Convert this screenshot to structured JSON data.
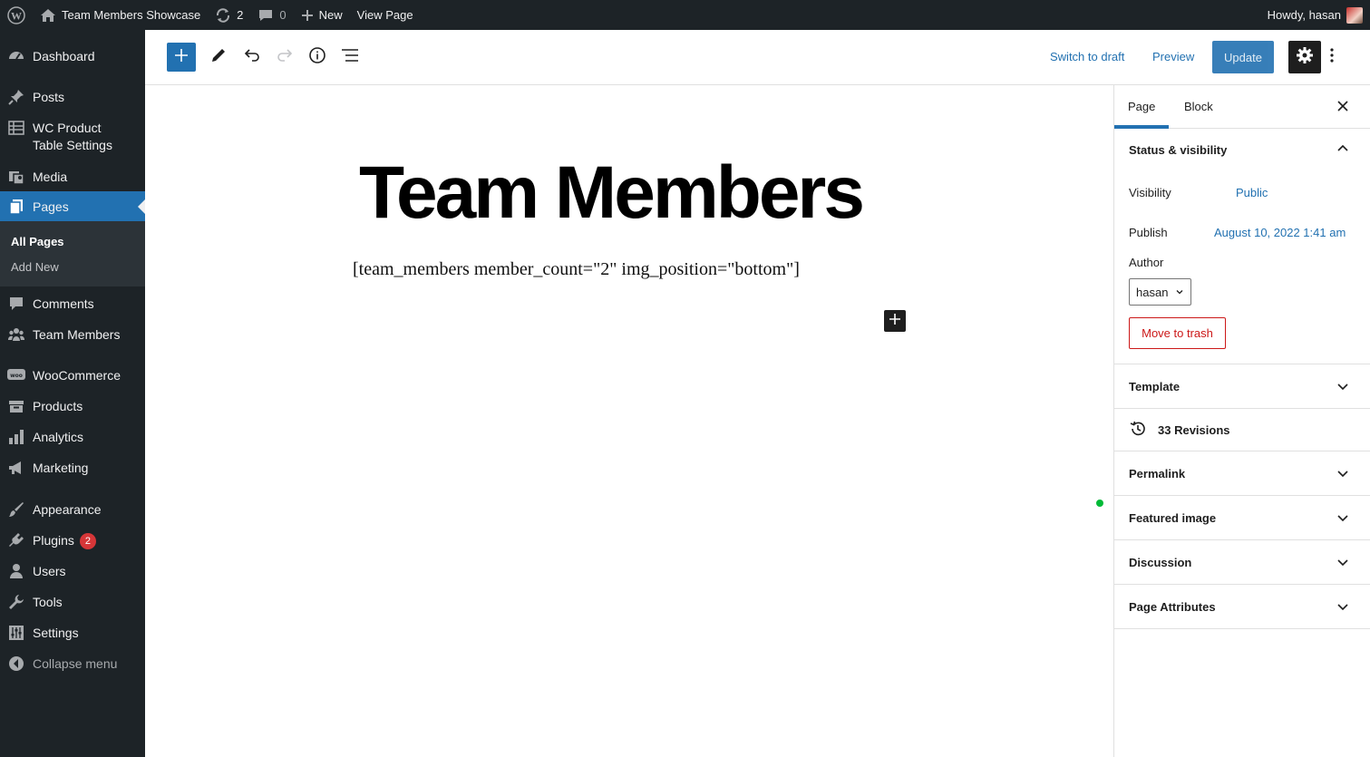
{
  "admin_bar": {
    "site_name": "Team Members Showcase",
    "updates_count": "2",
    "comments_count": "0",
    "new_label": "New",
    "view_page_label": "View Page",
    "howdy": "Howdy, hasan"
  },
  "sidebar": {
    "items": [
      {
        "label": "Dashboard",
        "icon": "dashboard-icon"
      },
      {
        "label": "Posts",
        "icon": "pin-icon"
      },
      {
        "label": "WC Product",
        "label2": "Table Settings",
        "icon": "table-icon"
      },
      {
        "label": "Media",
        "icon": "media-icon"
      },
      {
        "label": "Pages",
        "icon": "pages-icon"
      },
      {
        "label": "Comments",
        "icon": "comment-icon"
      },
      {
        "label": "Team Members",
        "icon": "groups-icon"
      },
      {
        "label": "WooCommerce",
        "icon": "woo-icon"
      },
      {
        "label": "Products",
        "icon": "archive-icon"
      },
      {
        "label": "Analytics",
        "icon": "bar-chart-icon"
      },
      {
        "label": "Marketing",
        "icon": "megaphone-icon"
      },
      {
        "label": "Appearance",
        "icon": "brush-icon"
      },
      {
        "label": "Plugins",
        "icon": "plugin-icon",
        "badge": "2"
      },
      {
        "label": "Users",
        "icon": "user-icon"
      },
      {
        "label": "Tools",
        "icon": "wrench-icon"
      },
      {
        "label": "Settings",
        "icon": "settings-icon"
      },
      {
        "label": "Collapse menu",
        "icon": "collapse-icon"
      }
    ],
    "submenu": [
      {
        "label": "All Pages"
      },
      {
        "label": "Add New"
      }
    ]
  },
  "toolbar": {
    "switch_to_draft": "Switch to draft",
    "preview": "Preview",
    "update": "Update"
  },
  "editor": {
    "title": "Team Members",
    "shortcode": "[team_members member_count=\"2\" img_position=\"bottom\"]"
  },
  "panel": {
    "tabs": [
      "Page",
      "Block"
    ],
    "status": {
      "title": "Status & visibility",
      "visibility_label": "Visibility",
      "visibility_value": "Public",
      "publish_label": "Publish",
      "publish_value": "August 10, 2022 1:41 am",
      "author_label": "Author",
      "author_value": "hasan",
      "trash_label": "Move to trash"
    },
    "sections": {
      "template": "Template",
      "revisions": "33 Revisions",
      "permalink": "Permalink",
      "featured_image": "Featured image",
      "discussion": "Discussion",
      "page_attributes": "Page Attributes"
    }
  },
  "colors": {
    "admin_dark": "#1d2327",
    "accent": "#2271b1",
    "danger": "#cc1818",
    "badge": "#d63638"
  }
}
